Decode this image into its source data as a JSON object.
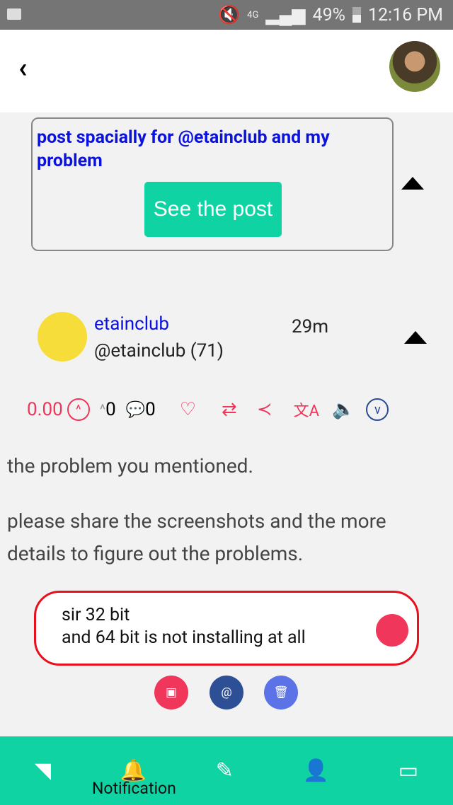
{
  "status_bar": {
    "battery": "49%",
    "time": "12:16 PM",
    "network": "4G"
  },
  "header": {
    "back_icon": "chevron-left-icon",
    "avatar": "user-avatar"
  },
  "linked_post": {
    "text": "post spacially for @etainclub and my problem",
    "button": "See the post"
  },
  "comment_author": {
    "name": "etainclub",
    "handle": "@etainclub (71)",
    "time": "29m"
  },
  "actions": {
    "payout": "0.00",
    "votes": "0",
    "comments": "0"
  },
  "body": {
    "p1": "the problem you mentioned.",
    "p2": "please share the screenshots and the more details to figure out the problems."
  },
  "reply": {
    "line1": "sir 32 bit",
    "line2": "and 64 bit is not installing at all"
  },
  "colors": {
    "accent": "#0fd3a3",
    "red": "#f0365a",
    "link": "#0b12e0"
  },
  "nav": {
    "notification_label": "Notification"
  }
}
